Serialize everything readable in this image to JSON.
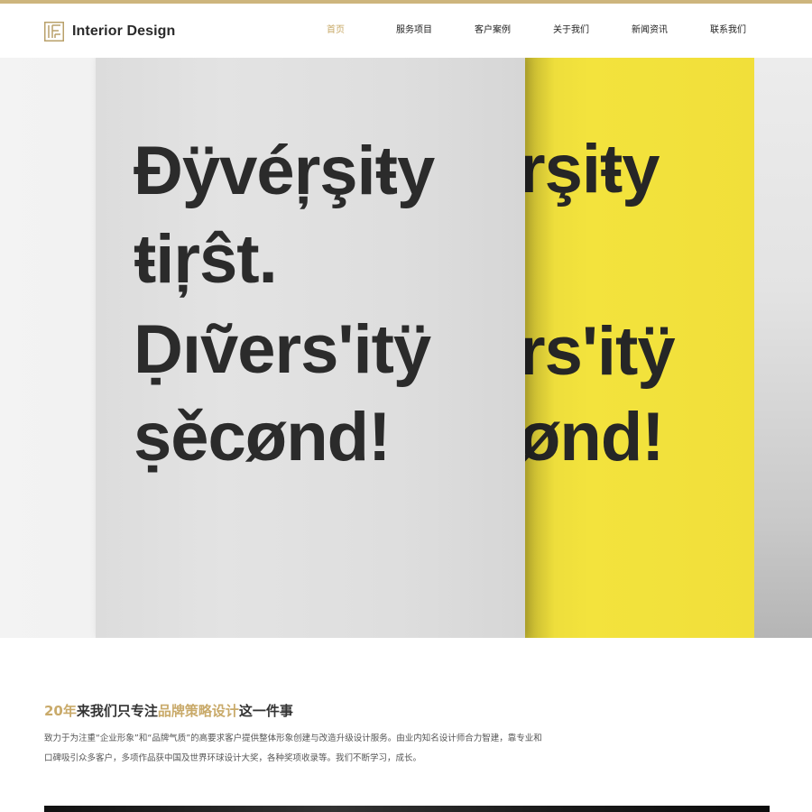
{
  "brand": {
    "name": "Interior Design",
    "accent_color": "#cdb57d",
    "active_nav_color": "#c7a866"
  },
  "nav": {
    "items": [
      {
        "label": "首页",
        "active": true
      },
      {
        "label": "服务项目",
        "active": false
      },
      {
        "label": "客户案例",
        "active": false
      },
      {
        "label": "关于我们",
        "active": false
      },
      {
        "label": "新闻资讯",
        "active": false
      },
      {
        "label": "联系我们",
        "active": false
      }
    ]
  },
  "hero": {
    "cover_white": [
      "Đÿvéŗşiŧy",
      "ŧiŗŝt.",
      "Ḍıṽerѕ'itÿ",
      "ṣěcønd!"
    ],
    "cover_yellow": [
      "rşiŧy",
      "rѕ'itÿ",
      "ønd!"
    ],
    "cover_colors": {
      "white_book": "#e0e0e0",
      "yellow_book": "#f1df3a"
    }
  },
  "intro": {
    "heading_prefix": "20年",
    "heading_mid1": "来我们只专注",
    "heading_highlight": "品牌策略设计",
    "heading_suffix": "这一件事",
    "body_line1": "致力于为注重“企业形象”和“品牌气质”的高要求客户提供整体形象创建与改造升级设计服务。由业内知名设计师合力智建，靠专业和",
    "body_line2": "口碑吸引众多客户，多项作品获中国及世界环球设计大奖，各种奖项收录等。我们不断学习，成长。"
  }
}
